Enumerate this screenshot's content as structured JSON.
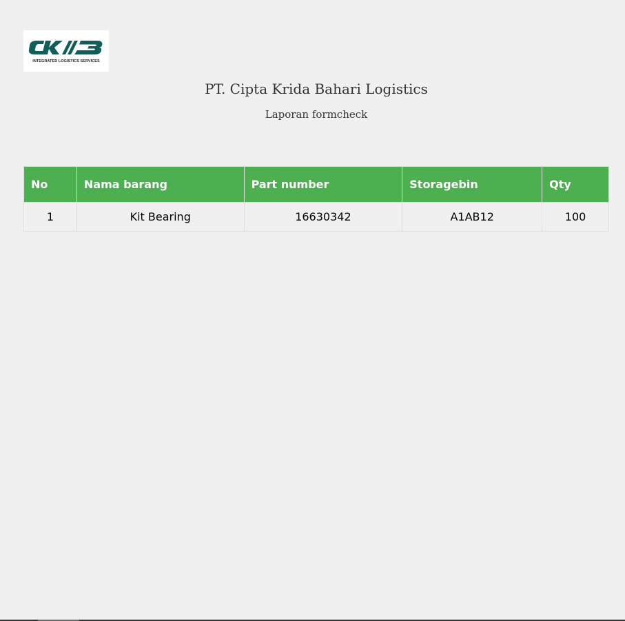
{
  "logo": {
    "mark": "CKB",
    "tagline": "INTEGRATED LOGISTICS SERVICES",
    "color": "#0f5e5a"
  },
  "header": {
    "company": "PT. Cipta Krida Bahari Logistics",
    "subtitle": "Laporan formcheck"
  },
  "table": {
    "header_color": "#4caf50",
    "columns": [
      "No",
      "Nama barang",
      "Part number",
      "Storagebin",
      "Qty"
    ],
    "rows": [
      [
        "1",
        "Kit Bearing",
        "16630342",
        "A1AB12",
        "100"
      ]
    ]
  }
}
